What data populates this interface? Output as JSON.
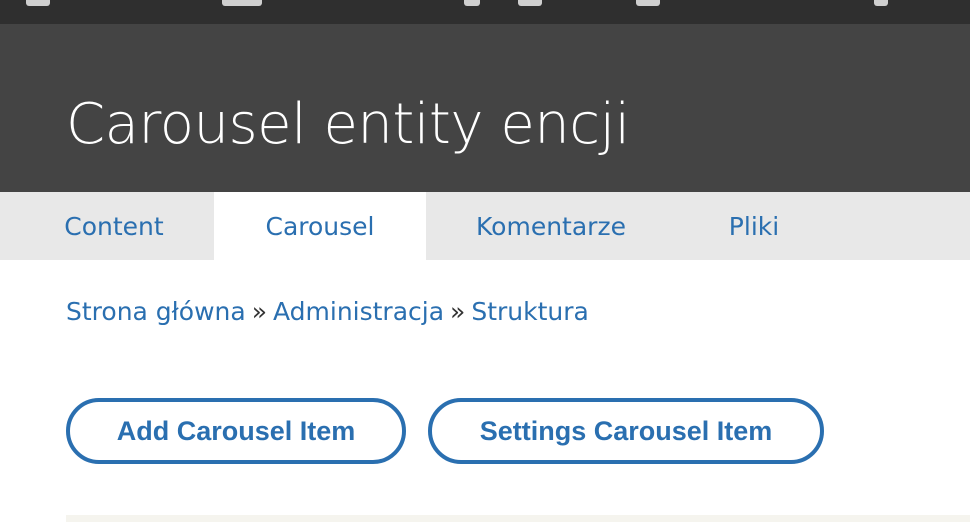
{
  "header": {
    "title": "Carousel entity encji"
  },
  "tabs": [
    {
      "label": "Content",
      "active": false
    },
    {
      "label": "Carousel",
      "active": true
    },
    {
      "label": "Komentarze",
      "active": false
    },
    {
      "label": "Pliki",
      "active": false
    }
  ],
  "breadcrumb": {
    "items": [
      "Strona główna",
      "Administracja",
      "Struktura"
    ],
    "separator": "»"
  },
  "actions": {
    "add_label": "Add Carousel Item",
    "settings_label": "Settings Carousel Item"
  },
  "colors": {
    "header_bg": "#444444",
    "toolbar_bg": "#2f2f2f",
    "tabs_bg": "#e8e8e8",
    "link": "#2a6fb0"
  }
}
